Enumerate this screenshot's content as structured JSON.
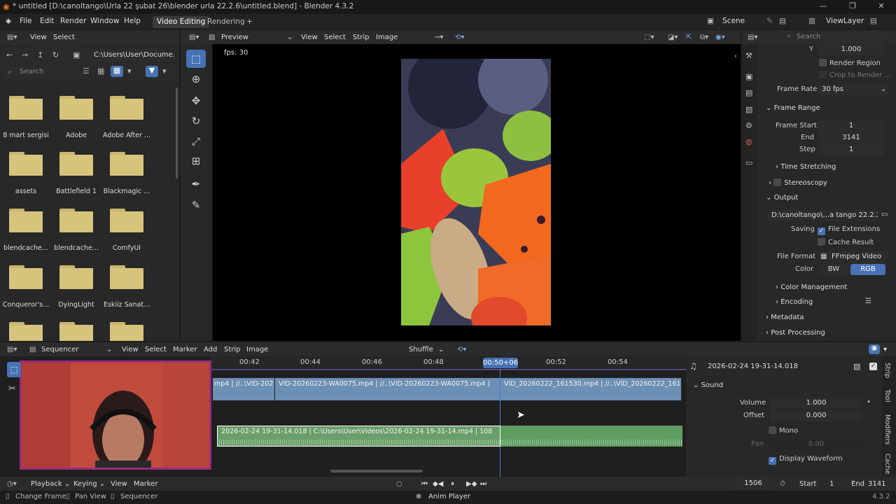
{
  "window": {
    "title": "* untitled [D:\\canoltango\\Urla 22 şubat 26\\blender urla 22.2.6\\untitled.blend] - Blender 4.3.2",
    "minimize": "—",
    "maximize": "❐",
    "close": "✕"
  },
  "menu": {
    "items": [
      "File",
      "Edit",
      "Render",
      "Window",
      "Help"
    ],
    "workspaces": [
      "Video Editing",
      "Rendering"
    ],
    "add_tab": "+",
    "scene": "Scene",
    "view_layer": "ViewLayer"
  },
  "file_browser": {
    "menu": [
      "View",
      "Select"
    ],
    "path": "C:\\Users\\User\\Docume...",
    "search_placeholder": "Search",
    "folders": [
      "8 mart sergisi",
      "Adobe",
      "Adobe After ...",
      "assets",
      "Battlefield 1",
      "Blackmagic ...",
      "blendcache...",
      "blendcache...",
      "ComfyUI",
      "Conqueror's...",
      "DyingLight",
      "Eskiiz Sanat..."
    ]
  },
  "preview": {
    "mode": "Preview",
    "menu": [
      "View",
      "Select",
      "Strip",
      "Image"
    ],
    "fps": "fps: 30"
  },
  "props": {
    "search_placeholder": "Search",
    "y_label": "Y",
    "y_value": "1.000",
    "render_region": "Render Region",
    "crop": "Crop to Render ...",
    "frame_rate_label": "Frame Rate",
    "frame_rate": "30 fps",
    "frame_range": "Frame Range",
    "frame_start_label": "Frame Start",
    "frame_start": "1",
    "end_label": "End",
    "end": "3141",
    "step_label": "Step",
    "step": "1",
    "time_stretching": "Time Stretching",
    "stereoscopy": "Stereoscopy",
    "output": "Output",
    "output_path": "D:\\canoltango\\...a tango 22.2.26",
    "saving": "Saving",
    "file_extensions": "File Extensions",
    "cache_result": "Cache Result",
    "file_format_label": "File Format",
    "file_format": "FFmpeg Video",
    "color_label": "Color",
    "bw": "BW",
    "rgb": "RGB",
    "color_management": "Color Management",
    "encoding": "Encoding",
    "metadata": "Metadata",
    "post_processing": "Post Processing"
  },
  "sequencer": {
    "mode": "Sequencer",
    "menu": [
      "View",
      "Select",
      "Marker",
      "Add",
      "Strip",
      "Image"
    ],
    "shuffle": "Shuffle",
    "ticks": [
      "00:42",
      "00:44",
      "00:46",
      "00:48",
      "00:52",
      "00:54"
    ],
    "current": "00:50+06",
    "strip1a": "mp4 | //..\\VID-202",
    "strip1b": "VID-20260223-WA0075.mp4 | //..\\VID-20260223-WA0075.mp4 |",
    "strip1c": "VID_20260222_161530.mp4 | //..\\VID_20260222_161530",
    "strip2": "2026-02-24 19-31-14.018 | C:\\Users\\User\\Videos\\2026-02-24 19-31-14.mp4 | 108"
  },
  "strip_props": {
    "name": "2026-02-24 19-31-14.018",
    "sound": "Sound",
    "volume_label": "Volume",
    "volume": "1.000",
    "offset_label": "Offset",
    "offset": "0.000",
    "mono": "Mono",
    "pan_label": "Pan",
    "pan": "0.00",
    "display_waveform": "Display Waveform",
    "tabs": [
      "Strip",
      "Tool",
      "Modifiers",
      "Cache"
    ]
  },
  "timeline": {
    "menu": [
      "Playback",
      "Keying",
      "View",
      "Marker"
    ],
    "frame": "1506",
    "start_label": "Start",
    "start": "1",
    "end_label": "End",
    "end": "3141"
  },
  "status": {
    "change_frame": "Change Frame",
    "pan_view": "Pan View",
    "sequencer": "Sequencer",
    "anim_player": "Anim Player",
    "version": "4.3.2"
  }
}
